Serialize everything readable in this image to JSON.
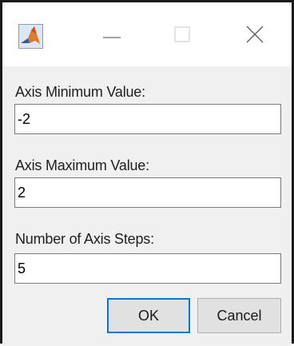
{
  "window": {
    "app_icon": "matlab-logo-icon",
    "controls": {
      "minimize_icon": "minimize-icon",
      "maximize_icon": "maximize-icon",
      "close_icon": "close-icon"
    }
  },
  "fields": [
    {
      "label": "Axis Minimum Value:",
      "value": "-2"
    },
    {
      "label": "Axis Maximum Value:",
      "value": "2"
    },
    {
      "label": "Number of Axis Steps:",
      "value": "5"
    }
  ],
  "buttons": {
    "ok_label": "OK",
    "cancel_label": "Cancel"
  },
  "colors": {
    "focus_accent": "#0078d7",
    "dialog_background": "#f0f0f0"
  }
}
